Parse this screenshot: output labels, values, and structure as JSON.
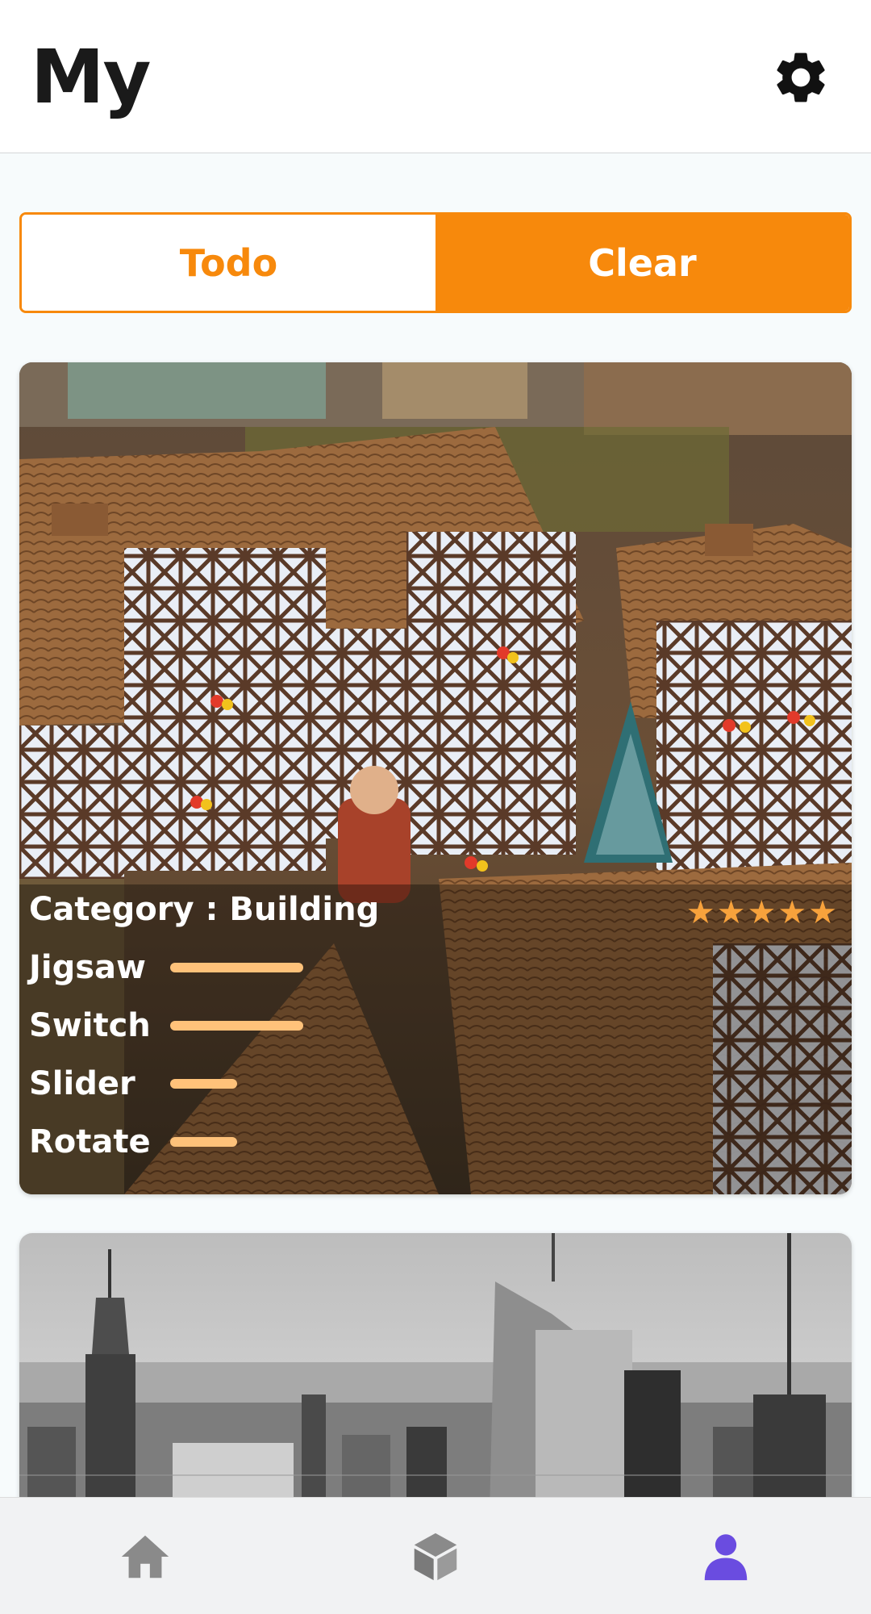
{
  "header": {
    "title": "My",
    "settings_icon": "gear-icon"
  },
  "tabs": {
    "todo_label": "Todo",
    "clear_label": "Clear",
    "selected": "Clear"
  },
  "cards": [
    {
      "image": "half-timbered miniature village houses",
      "category_text": "Category : Building",
      "stars": "★★★★★",
      "rating": 5,
      "stats": [
        {
          "label": "Jigsaw",
          "value": 1.0
        },
        {
          "label": "Switch",
          "value": 1.0
        },
        {
          "label": "Slider",
          "value": 0.5
        },
        {
          "label": "Rotate",
          "value": 0.5
        }
      ]
    },
    {
      "image": "black and white city skyline"
    }
  ],
  "navbar": {
    "items": [
      "home-icon",
      "cube-icon",
      "profile-icon"
    ],
    "active": "profile-icon"
  },
  "colors": {
    "accent": "#f7890c",
    "star": "#f7a23c",
    "bar": "#ffc27a",
    "nav_active": "#6a4ce0",
    "nav_inactive": "#8a8a8a"
  }
}
